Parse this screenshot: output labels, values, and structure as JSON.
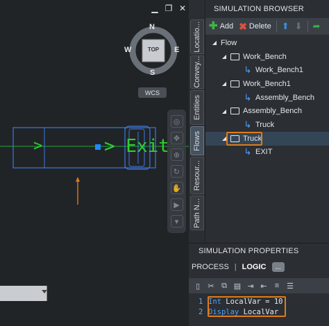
{
  "viewport": {
    "viewcube": {
      "north": "N",
      "south": "S",
      "east": "E",
      "west": "W",
      "face": "TOP"
    },
    "wcs_label": "WCS",
    "scene_label": "> Exit",
    "arrow_label": ">"
  },
  "vertical_tabs": [
    {
      "label": "Locatio..."
    },
    {
      "label": "Convey..."
    },
    {
      "label": "Entities"
    },
    {
      "label": "Flows"
    },
    {
      "label": "Resour..."
    },
    {
      "label": "Path N..."
    }
  ],
  "browser": {
    "title": "SIMULATION BROWSER",
    "toolbar": {
      "add_label": "Add",
      "delete_label": "Delete"
    },
    "tree": [
      {
        "label": "Flow",
        "level": 0,
        "kind": "root"
      },
      {
        "label": "Work_Bench",
        "level": 1,
        "kind": "box"
      },
      {
        "label": "Work_Bench1",
        "level": 2,
        "kind": "link"
      },
      {
        "label": "Work_Bench1",
        "level": 1,
        "kind": "box"
      },
      {
        "label": "Assembly_Bench",
        "level": 2,
        "kind": "link"
      },
      {
        "label": "Assembly_Bench",
        "level": 1,
        "kind": "box"
      },
      {
        "label": "Truck",
        "level": 2,
        "kind": "link"
      },
      {
        "label": "Truck",
        "level": 1,
        "kind": "box",
        "selected": true
      },
      {
        "label": "EXIT",
        "level": 2,
        "kind": "link"
      }
    ]
  },
  "properties": {
    "title": "SIMULATION PROPERTIES",
    "tabs": {
      "process": "PROCESS",
      "logic": "LOGIC",
      "more": "..."
    },
    "code": [
      {
        "num": "1",
        "keyword": "Int",
        "text": " LocalVar = 10"
      },
      {
        "num": "2",
        "keyword": "Display",
        "text": " LocalVar"
      }
    ]
  },
  "colors": {
    "highlight": "#e07b18",
    "accent_blue": "#4aa3ff",
    "green": "#2fcf2f"
  }
}
